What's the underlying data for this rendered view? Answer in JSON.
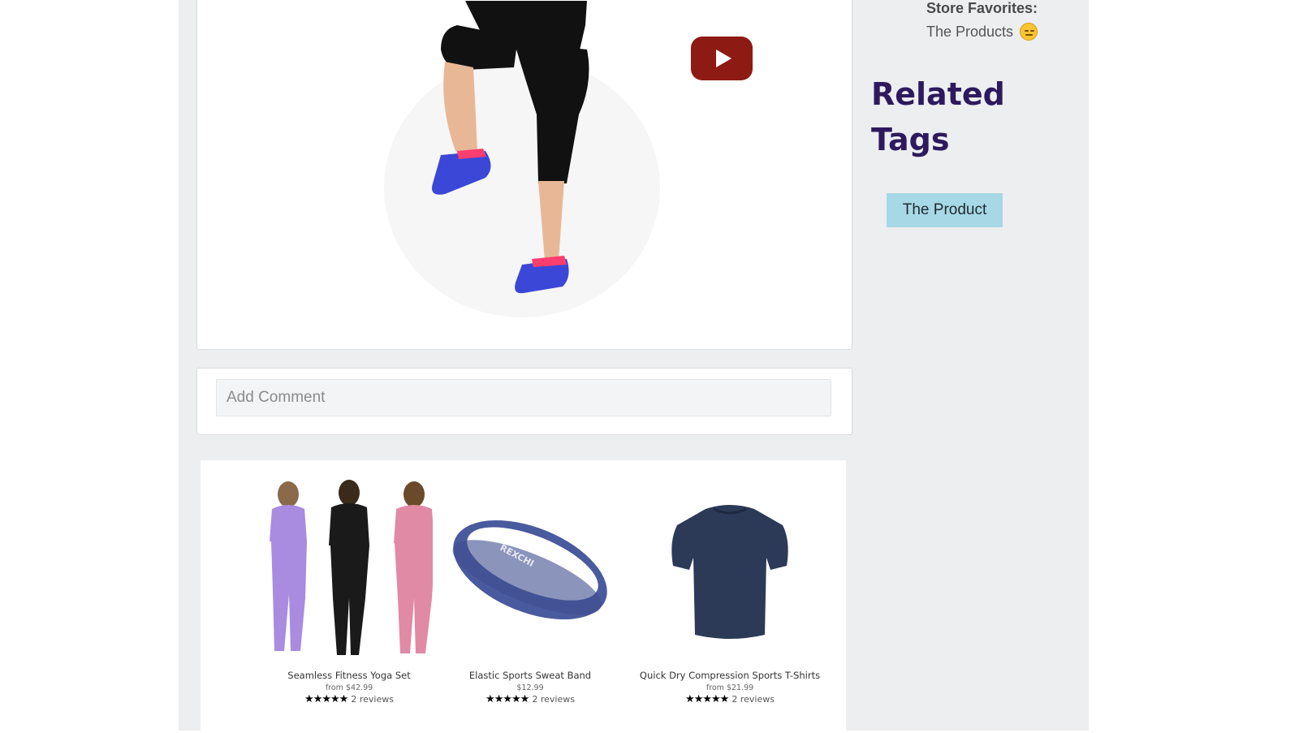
{
  "video": {
    "play_icon": "play-icon",
    "colors": {
      "play_button": "#8e1a14"
    }
  },
  "comment": {
    "placeholder": "Add Comment"
  },
  "products": [
    {
      "name": "Seamless Fitness Yoga Set",
      "price": "from $42.99",
      "rating": 5,
      "stars": "★★★★★",
      "reviews": "2 reviews"
    },
    {
      "name": "Elastic Sports Sweat Band",
      "price": "$12.99",
      "rating": 5,
      "stars": "★★★★★",
      "reviews": "2 reviews"
    },
    {
      "name": "Quick Dry Compression Sports T-Shirts",
      "price": "from $21.99",
      "rating": 5,
      "stars": "★★★★★",
      "reviews": "2 reviews"
    }
  ],
  "sidebar": {
    "store_favorites_title": "Store Favorites:",
    "store_favorites_item": "The Products",
    "store_favorites_icon": "smiley-emoji-icon",
    "related_tags_title": "Related Tags",
    "tags": [
      {
        "label": "The Product"
      }
    ]
  },
  "colors": {
    "page_background": "#edeef0",
    "heading": "#2d1a5e",
    "tag_background": "#a7d8e6"
  }
}
